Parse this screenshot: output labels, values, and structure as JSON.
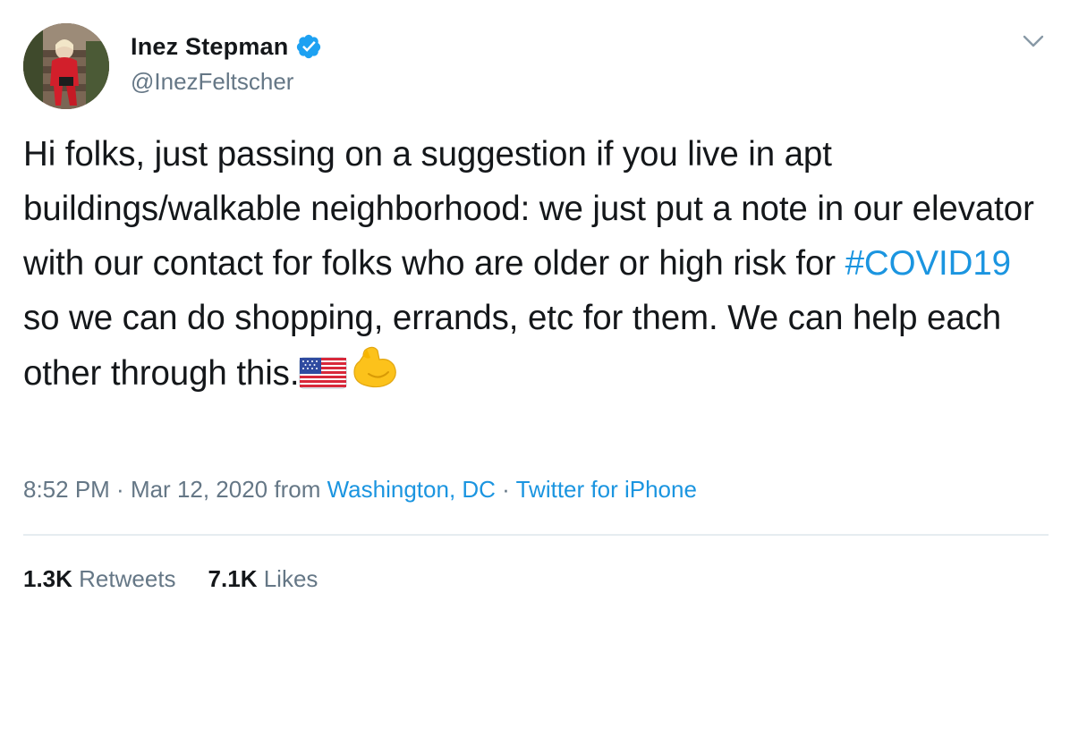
{
  "author": {
    "display_name": "Inez Stepman",
    "handle": "@InezFeltscher",
    "verified": true,
    "avatar_icon": "profile-photo"
  },
  "tweet": {
    "text_before_hashtag": "Hi folks, just passing on a suggestion if you live in apt buildings/walkable neighborhood: we just put a note in our elevator with our contact for folks who are older or high risk for ",
    "hashtag": "#COVID19",
    "text_after_hashtag": " so we can do shopping, errands, etc for them. We can help each other through this.",
    "emojis": [
      "us-flag-icon",
      "flexed-biceps-icon"
    ]
  },
  "meta": {
    "time": "8:52 PM",
    "separator": " · ",
    "date": "Mar 12, 2020",
    "from_label": " from ",
    "location": "Washington, DC",
    "source": "Twitter for iPhone"
  },
  "stats": {
    "retweets_count": "1.3K",
    "retweets_label": "Retweets",
    "likes_count": "7.1K",
    "likes_label": "Likes"
  },
  "colors": {
    "link": "#1b95e0",
    "secondary_text": "#657786",
    "primary_text": "#14171a",
    "divider": "#e6ecf0"
  }
}
